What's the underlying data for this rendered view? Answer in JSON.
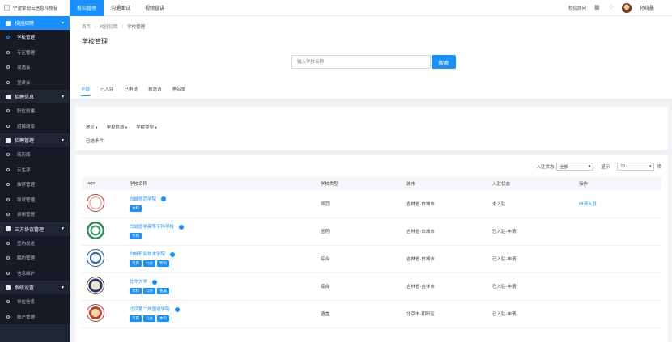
{
  "header": {
    "company": "宁波擎现云信息科技有",
    "nav": [
      "校招管理",
      "沟通面试",
      "视频宣讲"
    ],
    "help": "校招顾问",
    "user": "孙晓晨"
  },
  "sidebar": [
    {
      "label": "校园招聘",
      "active": true,
      "items": [
        {
          "label": "学校管理",
          "active": true
        },
        {
          "label": "专区管理"
        },
        {
          "label": "双选会"
        },
        {
          "label": "宣讲会"
        }
      ]
    },
    {
      "label": "招聘信息",
      "items": [
        {
          "label": "职位创建"
        },
        {
          "label": "招聘简章"
        }
      ]
    },
    {
      "label": "招聘管理",
      "items": [
        {
          "label": "简历库"
        },
        {
          "label": "云生源"
        },
        {
          "label": "推荐管理"
        },
        {
          "label": "面试管理"
        },
        {
          "label": "录用管理"
        }
      ]
    },
    {
      "label": "三方协议管理",
      "items": [
        {
          "label": "签约发送"
        },
        {
          "label": "解约管理"
        },
        {
          "label": "信息维护"
        }
      ]
    },
    {
      "label": "系统设置",
      "items": [
        {
          "label": "单位信息"
        },
        {
          "label": "账户管理"
        }
      ]
    }
  ],
  "main": {
    "breadcrumb": [
      "首页",
      "校园招聘",
      "学校管理"
    ],
    "title": "学校管理",
    "search_placeholder": "输入学校名称",
    "search_button": "搜索",
    "tabs": [
      "全部",
      "已入驻",
      "已申请",
      "被邀请",
      "黑名单"
    ],
    "filters": [
      "地区",
      "学校性质",
      "学校类型"
    ],
    "selected_label": "已选条件:",
    "status_label": "入驻状态",
    "status_value": "全部",
    "show_label": "显示",
    "show_value": "10",
    "show_unit": "项",
    "columns": [
      "logo",
      "学校名称",
      "学校类型",
      "城市",
      "入驻状态",
      "操作"
    ],
    "rows": [
      {
        "name": "白城师范学院",
        "tags": [
          "本科"
        ],
        "type": "师范",
        "city": "吉林省-白城市",
        "status": "未入驻",
        "action": "申请入驻"
      },
      {
        "name": "白城医学高等专科学校",
        "tags": [
          "专科"
        ],
        "type": "医药",
        "city": "吉林省-白城市",
        "status": "已入驻-申请",
        "action": ""
      },
      {
        "name": "白城职业技术学院",
        "tags": [
          "市属",
          "公办",
          "专科"
        ],
        "type": "综合",
        "city": "吉林省-白城市",
        "status": "已入驻-申请",
        "action": ""
      },
      {
        "name": "北华大学",
        "tags": [
          "本科",
          "公办",
          "省属"
        ],
        "type": "综合",
        "city": "吉林省-吉林市",
        "status": "已入驻-申请",
        "action": ""
      },
      {
        "name": "北京第二外国语学院",
        "tags": [
          "市属",
          "公办",
          "本科"
        ],
        "type": "语言",
        "city": "北京市-朝阳区",
        "status": "已入驻-申请",
        "action": ""
      }
    ]
  },
  "colors": {
    "accent": "#1890ff",
    "sidebar_bg": "#1f2533"
  }
}
